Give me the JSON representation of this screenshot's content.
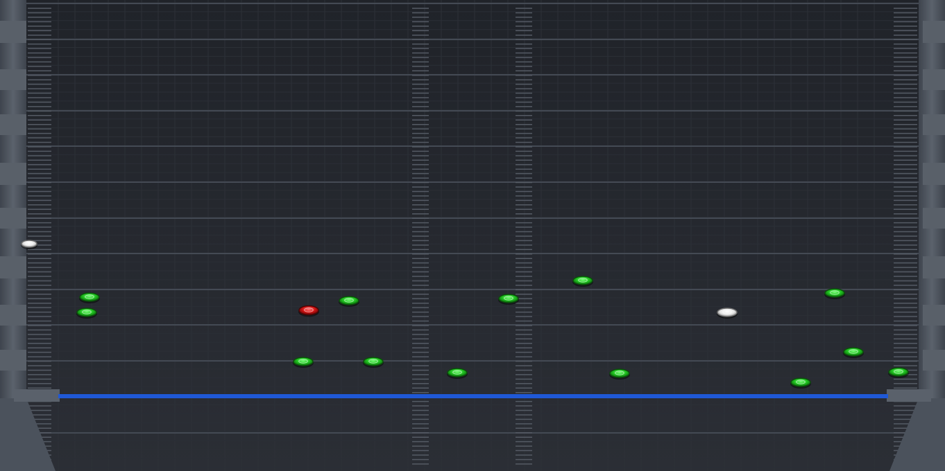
{
  "game": {
    "view": "rhythm-game-note-highway",
    "colors": {
      "background": "#25282f",
      "grid_line": "#2f333b",
      "lane_line": "#3a3f48",
      "side_pillar": "#4b525c",
      "hit_line": "#1f58d6",
      "note_green": "#1fc21f",
      "note_red": "#d01212",
      "note_white": "#f2f2f2"
    },
    "notes": [
      {
        "color": "white"
      },
      {
        "color": "green"
      },
      {
        "color": "green"
      },
      {
        "color": "red"
      },
      {
        "color": "green"
      },
      {
        "color": "green"
      },
      {
        "color": "green"
      },
      {
        "color": "green"
      },
      {
        "color": "green"
      },
      {
        "color": "green"
      },
      {
        "color": "green"
      },
      {
        "color": "white"
      },
      {
        "color": "green"
      },
      {
        "color": "green"
      },
      {
        "color": "green"
      },
      {
        "color": "green"
      }
    ]
  }
}
